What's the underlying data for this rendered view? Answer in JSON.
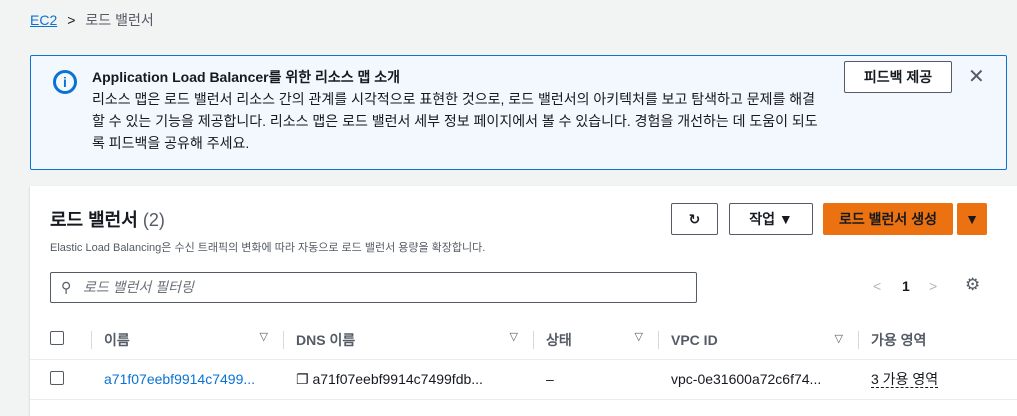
{
  "breadcrumb": {
    "root": "EC2",
    "current": "로드 밸런서"
  },
  "flash": {
    "title": "Application Load Balancer를 위한 리소스 맵 소개",
    "body": "리소스 맵은 로드 밸런서 리소스 간의 관계를 시각적으로 표현한 것으로, 로드 밸런서의 아키텍처를 보고 탐색하고 문제를 해결할 수 있는 기능을 제공합니다. 리소스 맵은 로드 밸런서 세부 정보 페이지에서 볼 수 있습니다. 경험을 개선하는 데 도움이 되도록 피드백을 공유해 주세요.",
    "feedback": "피드백 제공"
  },
  "panel": {
    "title": "로드 밸런서",
    "count": "(2)",
    "description": "Elastic Load Balancing은 수신 트래픽의 변화에 따라 자동으로 로드 밸런서 용량을 확장합니다.",
    "actions": "작업",
    "create": "로드 밸런서 생성",
    "search_placeholder": "로드 밸런서 필터링",
    "page": "1"
  },
  "table": {
    "headers": [
      "이름",
      "DNS 이름",
      "상태",
      "VPC ID",
      "가용 영역"
    ],
    "rows": [
      {
        "name": "a71f07eebf9914c7499...",
        "dns": "a71f07eebf9914c7499fdb...",
        "state": "–",
        "vpc": "vpc-0e31600a72c6f74...",
        "az": "3 가용 영역"
      }
    ]
  }
}
